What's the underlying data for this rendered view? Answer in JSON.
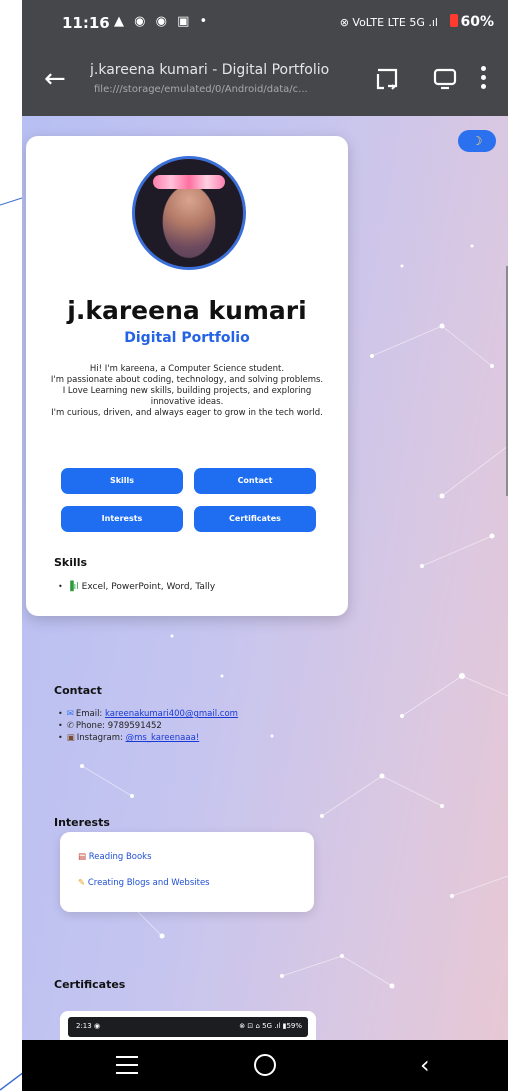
{
  "status_bar": {
    "time": "11:16",
    "left_icons": "▲ ◉ ◉ ▣ •",
    "right_icons": "⊗ VoLTE  LTE  5G .ıl",
    "battery": "60%"
  },
  "toolbar": {
    "title": "j.kareena kumari - Digital Portfolio",
    "url": "file:///storage/emulated/0/Android/data/c..."
  },
  "profile": {
    "name": "j.kareena kumari",
    "subtitle": "Digital Portfolio",
    "bio": [
      "Hi! I'm kareena, a Computer Science student.",
      "I'm passionate about coding, technology, and solving problems.",
      "I Love Learning new skills, building projects, and exploring",
      "innovative ideas.",
      "I'm curious, driven, and always eager to grow in the tech world."
    ]
  },
  "buttons": {
    "skills": "Skills",
    "contact": "Contact",
    "interests": "Interests",
    "certificates": "Certificates"
  },
  "skills": {
    "heading": "Skills",
    "items": [
      "Excel, PowerPoint, Word, Tally"
    ]
  },
  "contact": {
    "heading": "Contact",
    "email_label": "Email:",
    "email": "kareenakumari400@gmail.com",
    "phone_label": "Phone:",
    "phone": "9789591452",
    "instagram_label": "Instagram:",
    "instagram": "@ms_kareenaaa!"
  },
  "interests": {
    "heading": "Interests",
    "items": [
      "Reading Books",
      "Creating Blogs and Websites"
    ]
  },
  "certificates": {
    "heading": "Certificates",
    "preview_time": "2:13 ◉",
    "preview_status": "⊗ ⊡ ⌂ 5G .ıl ▮59%"
  },
  "theme_toggle": {
    "icon": "moon-icon",
    "glyph": "☽"
  },
  "colors": {
    "accent": "#1f6ef2",
    "toolbar": "#45474b",
    "link": "#1a3ad6"
  }
}
